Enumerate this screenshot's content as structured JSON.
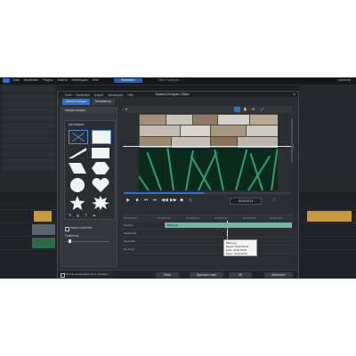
{
  "app": {
    "menu": [
      "Datei",
      "Bearbeiten",
      "Plugins",
      "Ansicht",
      "Wiedergabe",
      "Hilfe"
    ],
    "mode_button": "Bearbeiten",
    "center_title": "Mein Projekt.pds",
    "right_info": "CyberLink"
  },
  "dialog": {
    "title": "Masken-Designer | Bilder",
    "menu": [
      "Datei",
      "Bearbeiten",
      "Ansicht",
      "Wiedergabe",
      "Hilfe"
    ],
    "tabs": [
      "Maskenvorlagen",
      "Bearbeitung"
    ],
    "section_header": "Maskenvorlagen",
    "shapes_caption": "Alle Masken",
    "options": [
      "Maske umkehren",
      "Feathering"
    ],
    "timecode": "00;00;02;16",
    "bottom_note": "Nur die ausgewählte Spur anzeigen",
    "buttons": [
      "Teilen",
      "Speichern unter",
      "OK",
      "Abbrechen"
    ]
  },
  "timeline": {
    "ruler": [
      "00;00;00;00",
      "00;00;01;00",
      "00;00;02;00",
      "00;00;03;00",
      "00;00;04;00",
      "00;00;05;00"
    ],
    "rows": [
      {
        "label": "Position",
        "clip": "Bilder.jpg"
      },
      {
        "label": "Skalierung",
        "clip": ""
      },
      {
        "label": "Deckkraft",
        "clip": ""
      },
      {
        "label": "Drehung",
        "clip": ""
      }
    ],
    "tooltip": [
      "Bilder.jpg",
      "Beginn: 00;00;00;00",
      "Ende: 00;00;05;00",
      "Dauer: 00;00;05;00"
    ]
  },
  "colors": {
    "accent": "#2f6fd1",
    "clip": "#6fb6a6"
  }
}
